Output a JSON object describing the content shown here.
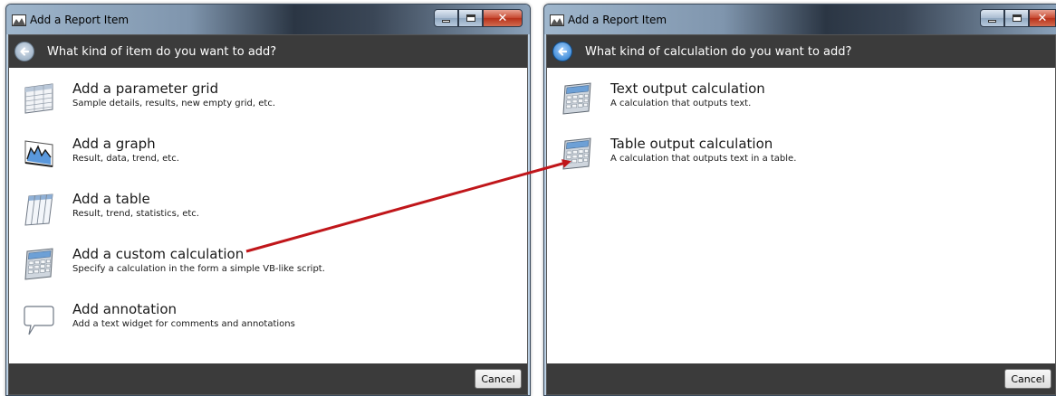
{
  "window1": {
    "title": "Add a Report Item",
    "header_title": "What kind of item do you want to add?",
    "items": [
      {
        "icon": "parameter-grid-icon",
        "title": "Add a parameter grid",
        "desc": "Sample details, results, new empty grid, etc."
      },
      {
        "icon": "graph-icon",
        "title": "Add a graph",
        "desc": "Result, data, trend, etc."
      },
      {
        "icon": "table-icon",
        "title": "Add a table",
        "desc": "Result, trend, statistics, etc."
      },
      {
        "icon": "calculator-icon",
        "title": "Add a custom calculation",
        "desc": "Specify a calculation in the form a simple VB-like script."
      },
      {
        "icon": "speech-bubble-icon",
        "title": "Add annotation",
        "desc": "Add a text widget for comments and annotations"
      }
    ],
    "cancel_label": "Cancel"
  },
  "window2": {
    "title": "Add a Report Item",
    "header_title": "What kind of calculation do you want to add?",
    "items": [
      {
        "icon": "calculator-icon",
        "title": "Text output calculation",
        "desc": "A calculation that outputs text."
      },
      {
        "icon": "calculator-icon",
        "title": "Table output calculation",
        "desc": "A calculation that outputs text in a table."
      }
    ],
    "cancel_label": "Cancel"
  },
  "colors": {
    "header_bg": "#3b3b3b",
    "arrow": "#c0161a",
    "back_button_active": "#1f74c9"
  }
}
